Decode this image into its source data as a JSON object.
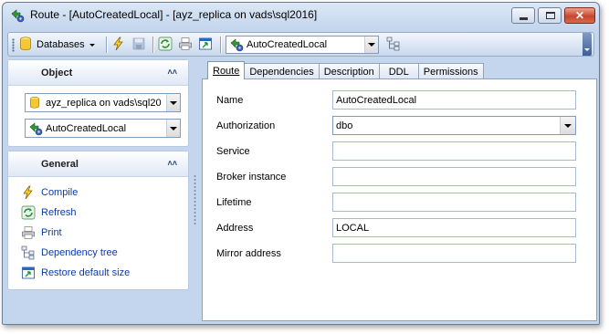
{
  "window": {
    "title": "Route - [AutoCreatedLocal] - [ayz_replica on vads\\sql2016]",
    "icon": "route-icon"
  },
  "toolbar": {
    "databases_label": "Databases",
    "object_combo_value": "AutoCreatedLocal",
    "icons": [
      "database-icon",
      "lightning-compile-icon",
      "save-icon",
      "refresh-icon",
      "print-icon",
      "restore-size-icon",
      "route-icon",
      "dependency-tree-icon"
    ]
  },
  "sidebar": {
    "object_panel": {
      "title": "Object",
      "database_value": "ayz_replica on vads\\sql20",
      "object_value": "AutoCreatedLocal"
    },
    "general_panel": {
      "title": "General",
      "items": [
        {
          "label": "Compile",
          "icon": "lightning-icon"
        },
        {
          "label": "Refresh",
          "icon": "refresh-icon"
        },
        {
          "label": "Print",
          "icon": "print-icon"
        },
        {
          "label": "Dependency tree",
          "icon": "dependency-tree-icon"
        },
        {
          "label": "Restore default size",
          "icon": "restore-size-icon"
        }
      ]
    }
  },
  "tabs": [
    {
      "label": "Route",
      "active": true
    },
    {
      "label": "Dependencies",
      "active": false
    },
    {
      "label": "Description",
      "active": false
    },
    {
      "label": "DDL",
      "active": false
    },
    {
      "label": "Permissions",
      "active": false
    }
  ],
  "form": {
    "fields": [
      {
        "label": "Name",
        "value": "AutoCreatedLocal",
        "type": "text"
      },
      {
        "label": "Authorization",
        "value": "dbo",
        "type": "select"
      },
      {
        "label": "Service",
        "value": "",
        "type": "text"
      },
      {
        "label": "Broker instance",
        "value": "",
        "type": "text"
      },
      {
        "label": "Lifetime",
        "value": "",
        "type": "text"
      },
      {
        "label": "Address",
        "value": "LOCAL",
        "type": "text"
      },
      {
        "label": "Mirror address",
        "value": "",
        "type": "text"
      }
    ]
  },
  "colors": {
    "link": "#0a3ca8",
    "chrome": "#c3d6ee",
    "close_button": "#c9452c"
  }
}
